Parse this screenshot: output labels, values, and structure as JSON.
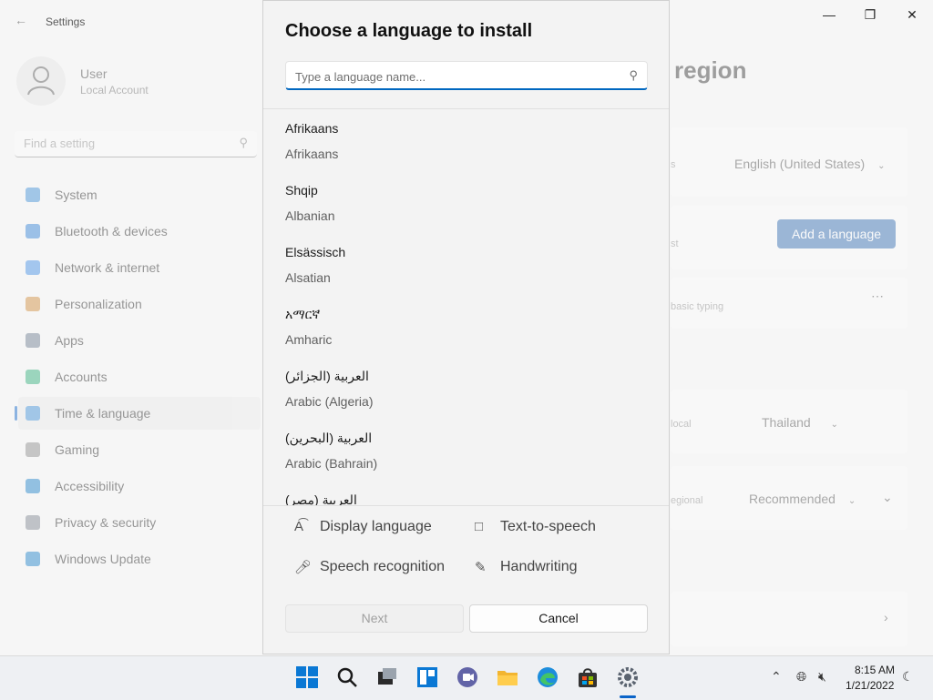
{
  "settings": {
    "app_title": "Settings",
    "user": {
      "name": "User",
      "account": "Local Account"
    },
    "search_placeholder": "Find a setting",
    "nav": [
      {
        "label": "System",
        "color": "#3b8ed6"
      },
      {
        "label": "Bluetooth & devices",
        "color": "#2f7fd6"
      },
      {
        "label": "Network & internet",
        "color": "#3f8ee6"
      },
      {
        "label": "Personalization",
        "color": "#d08a3a"
      },
      {
        "label": "Apps",
        "color": "#6b7b8f"
      },
      {
        "label": "Accounts",
        "color": "#2fae7a"
      },
      {
        "label": "Time & language",
        "color": "#3b8ed6"
      },
      {
        "label": "Gaming",
        "color": "#8c8c8c"
      },
      {
        "label": "Accessibility",
        "color": "#1a7fc8"
      },
      {
        "label": "Privacy & security",
        "color": "#7d8590"
      },
      {
        "label": "Windows Update",
        "color": "#1a7fc8"
      }
    ],
    "active_nav": "Time & language",
    "page_heading": "region",
    "display_language_value": "English (United States)",
    "add_language_button": "Add a language",
    "preferred_lang_sub": "basic typing",
    "row_muted_1": "s",
    "row_muted_2": "st",
    "row_muted_3": "local",
    "row_muted_4": "egional",
    "country_value": "Thailand",
    "regional_format_value": "Recommended"
  },
  "dialog": {
    "title": "Choose a language to install",
    "search_placeholder": "Type a language name...",
    "languages": [
      {
        "native": "Afrikaans",
        "english": "Afrikaans"
      },
      {
        "native": "Shqip",
        "english": "Albanian"
      },
      {
        "native": "Elsässisch",
        "english": "Alsatian"
      },
      {
        "native": "አማርኛ",
        "english": "Amharic"
      },
      {
        "native": "العربية (الجزائر)",
        "english": "Arabic (Algeria)"
      },
      {
        "native": "العربية (البحرين)",
        "english": "Arabic (Bahrain)"
      },
      {
        "native": "العربية (مصر)",
        "english": ""
      }
    ],
    "features": {
      "display_language": "Display language",
      "text_to_speech": "Text-to-speech",
      "speech_recognition": "Speech recognition",
      "handwriting": "Handwriting"
    },
    "next_button": "Next",
    "cancel_button": "Cancel"
  },
  "taskbar": {
    "time": "8:15 AM",
    "date": "1/21/2022"
  }
}
